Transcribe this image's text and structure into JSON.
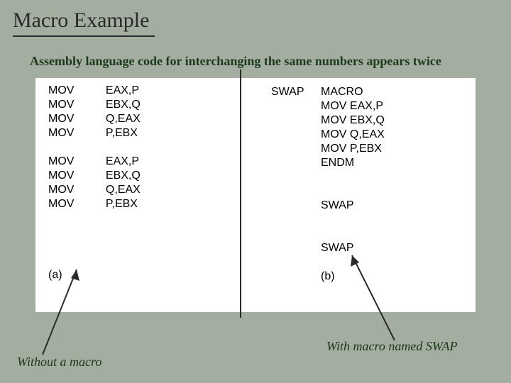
{
  "title": "Macro Example",
  "subtitle": "Assembly language code  for interchanging the same numbers appears twice",
  "code_a": "MOV          EAX,P\nMOV          EBX,Q\nMOV          Q,EAX\nMOV          P,EBX\n\nMOV          EAX,P\nMOV          EBX,Q\nMOV          Q,EAX\nMOV          P,EBX\n\n\n\n\n(a)",
  "code_b_label": "SWAP",
  "code_b_body": "MACRO\nMOV EAX,P\nMOV EBX,Q\nMOV Q,EAX\nMOV P,EBX\nENDM\n\n\nSWAP\n\n\nSWAP\n\n(b)",
  "caption_left": "Without  a macro",
  "caption_right": "With  macro named SWAP"
}
